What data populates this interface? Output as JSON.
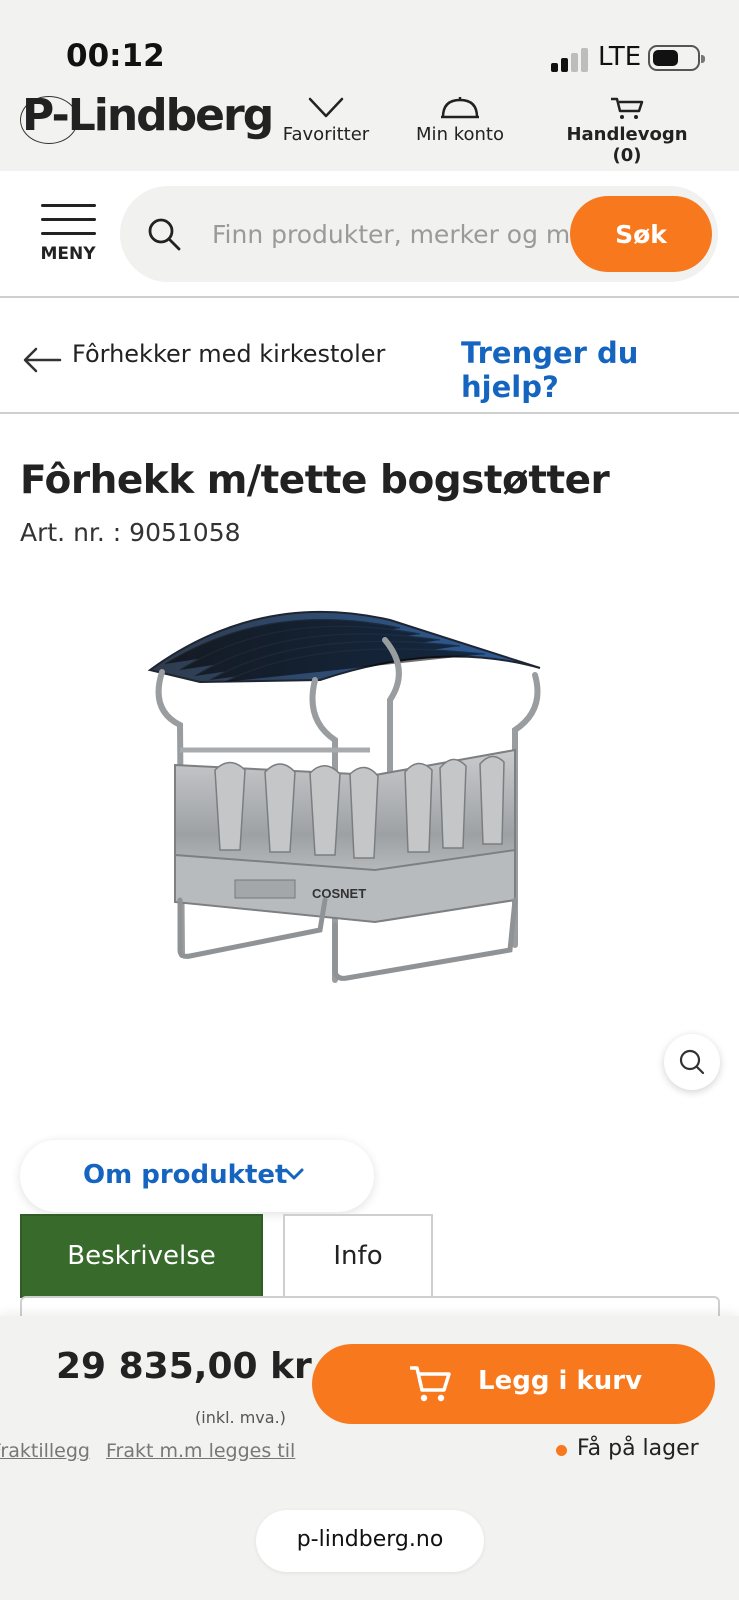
{
  "status_bar": {
    "time": "00:12",
    "network": "LTE"
  },
  "header": {
    "logo": "P-Lindberg",
    "nav": {
      "favorites": "Favoritter",
      "account": "Min konto",
      "cart": "Handlevogn (0)"
    }
  },
  "search": {
    "menu_label": "MENY",
    "placeholder": "Finn produkter, merker og merker",
    "button": "Søk"
  },
  "breadcrumb": {
    "back_label": "Fôrhekker med kirkestoler",
    "help_link": "Trenger du hjelp?"
  },
  "product": {
    "title": "Fôrhekk m/tette bogstøtter",
    "article_number": "Art. nr. : 9051058",
    "image_icon": "hay-feeder-image",
    "brand_on_image": "COSNET"
  },
  "details": {
    "toggle_label": "Om produktet",
    "tabs": [
      {
        "label": "Beskrivelse",
        "active": true
      },
      {
        "label": "Info",
        "active": false
      }
    ]
  },
  "purchase": {
    "price": "29 835,00 kr",
    "vat_note": "(inkl. mva.)",
    "freight_links": [
      "Fraktillegg",
      "Frakt m.m legges til"
    ],
    "add_to_cart": "Legg i kurv",
    "stock_status": "Få på lager"
  },
  "browser": {
    "url": "p-lindberg.no"
  },
  "colors": {
    "accent_orange": "#f8781e",
    "link_blue": "#1565c0",
    "active_tab_green": "#376a2b"
  }
}
